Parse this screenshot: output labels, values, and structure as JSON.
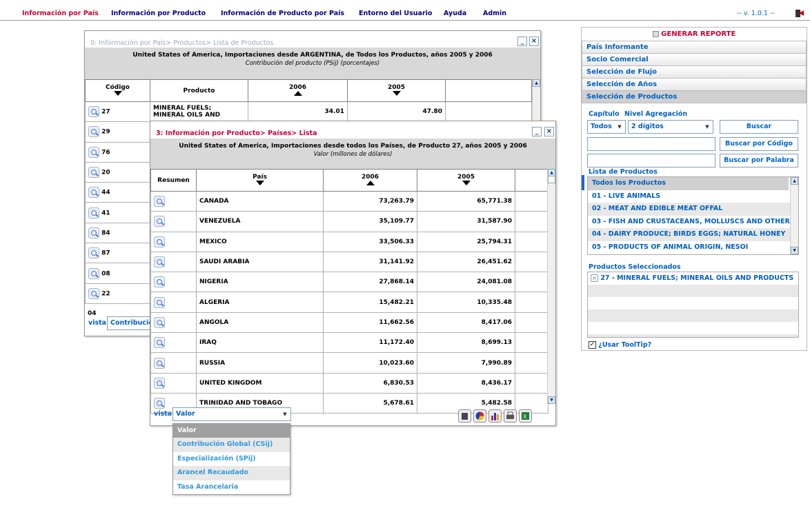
{
  "menu": {
    "items": [
      {
        "label": "Información por País"
      },
      {
        "label": "Información por Producto"
      },
      {
        "label": "Información de Producto por País"
      },
      {
        "label": "Entorno del Usuario"
      },
      {
        "label": "Ayuda"
      },
      {
        "label": "Admin"
      }
    ],
    "version": "-- v. 1.0.1 --"
  },
  "win0": {
    "title": "0: Información por País> Productos> Lista de Productos",
    "subtitle": "United States of America, Importaciones desde ARGENTINA, de Todos los Productos, años 2005 y 2006",
    "subtitle2": "Contribución del producto (PSij) (porcentajes)",
    "headers": {
      "codigo": "Código",
      "producto": "Producto",
      "y2006": "2006",
      "y2005": "2005"
    },
    "rows": [
      {
        "code": "27",
        "product": "MINERAL FUELS;",
        "product2": "MINERAL OILS AND",
        "v2006": "34.01",
        "v2005": "47.80"
      },
      {
        "code": "29"
      },
      {
        "code": "76"
      },
      {
        "code": "20"
      },
      {
        "code": "44"
      },
      {
        "code": "41"
      },
      {
        "code": "84"
      },
      {
        "code": "87"
      },
      {
        "code": "08"
      },
      {
        "code": "22"
      },
      {
        "code": "04"
      }
    ],
    "vista_label": "vista",
    "vista_value": "Contribució"
  },
  "win3": {
    "title": "3: Información por Producto> Países> Lista",
    "subtitle": "United States of America, Importaciones desde todos los Países, de Producto 27, años 2005 y 2006",
    "subtitle2": "Valor (millones de dólares)",
    "headers": {
      "resumen": "Resumen",
      "pais": "País",
      "y2006": "2006",
      "y2005": "2005"
    },
    "rows": [
      {
        "country": "CANADA",
        "v2006": "73,263.79",
        "v2005": "65,771.38"
      },
      {
        "country": "VENEZUELA",
        "v2006": "35,109.77",
        "v2005": "31,587.90"
      },
      {
        "country": "MEXICO",
        "v2006": "33,506.33",
        "v2005": "25,794.31"
      },
      {
        "country": "SAUDI ARABIA",
        "v2006": "31,141.92",
        "v2005": "26,451.62"
      },
      {
        "country": "NIGERIA",
        "v2006": "27,868.14",
        "v2005": "24,081.08"
      },
      {
        "country": "ALGERIA",
        "v2006": "15,482.21",
        "v2005": "10,335.48"
      },
      {
        "country": "ANGOLA",
        "v2006": "11,662.56",
        "v2005": "8,417.06"
      },
      {
        "country": "IRAQ",
        "v2006": "11,172.40",
        "v2005": "8,699.13"
      },
      {
        "country": "RUSSIA",
        "v2006": "10,023.60",
        "v2005": "7,990.89"
      },
      {
        "country": "UNITED KINGDOM",
        "v2006": "6,830.53",
        "v2005": "8,436.17"
      },
      {
        "country": "TRINIDAD AND TOBAGO",
        "v2006": "5,678.61",
        "v2005": "5,482.58"
      }
    ],
    "vista_label": "vista",
    "vista_value": "Valor",
    "dropdown": [
      "Valor",
      "Contribución Global (CSij)",
      "Especialización (SPij)",
      "Arancel Recaudado",
      "Tasa Arancelaria"
    ]
  },
  "panel": {
    "generar": "GENERAR REPORTE",
    "sections": [
      "País Informante",
      "Socio Comercial",
      "Selección de Flujo",
      "Selección de Años",
      "Selección de Productos"
    ],
    "capitulo_label": "Capítulo",
    "nivel_label": "Nivel Agregación",
    "capitulo_value": "Todos",
    "nivel_value": "2 dígitos",
    "buscar": "Buscar",
    "buscar_codigo": "Buscar por Código",
    "buscar_palabra": "Buscar por Palabra",
    "lista_label": "Lista de Productos",
    "lista": [
      "Todos los Productos",
      "01 - LIVE ANIMALS",
      "02 - MEAT AND EDIBLE MEAT OFFAL",
      "03 - FISH AND CRUSTACEANS, MOLLUSCS AND OTHER",
      "04 - DAIRY PRODUCE; BIRDS EGGS; NATURAL HONEY",
      "05 - PRODUCTS OF ANIMAL ORIGIN, NESOI"
    ],
    "seleccionados_label": "Productos Seleccionados",
    "seleccionados": [
      "27 - MINERAL FUELS; MINERAL OILS AND PRODUCTS"
    ],
    "tooltip_label": "¿Usar ToolTip?"
  },
  "colors": {
    "accent": "#cc0033",
    "link": "#0060c0",
    "menu": "#00007a"
  }
}
